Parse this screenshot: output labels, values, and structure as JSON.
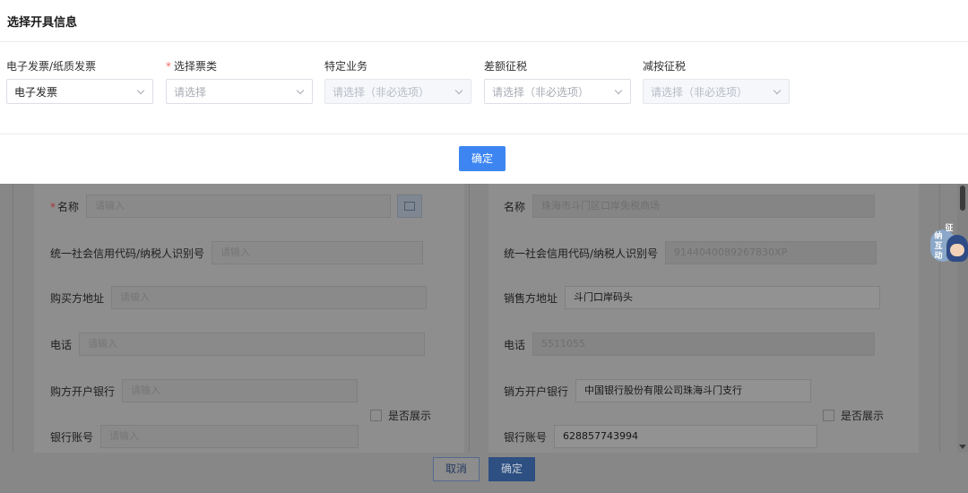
{
  "modal": {
    "title": "选择开具信息",
    "fields": [
      {
        "label": "电子发票/纸质发票",
        "required": false,
        "value": "电子发票",
        "placeholder": "",
        "disabled": false
      },
      {
        "label": "选择票类",
        "required": true,
        "value": "",
        "placeholder": "请选择",
        "disabled": false
      },
      {
        "label": "特定业务",
        "required": false,
        "value": "",
        "placeholder": "请选择（非必选项）",
        "disabled": true
      },
      {
        "label": "差额征税",
        "required": false,
        "value": "",
        "placeholder": "请选择（非必选项）",
        "disabled": false
      },
      {
        "label": "减按征税",
        "required": false,
        "value": "",
        "placeholder": "请选择（非必选项）",
        "disabled": true
      }
    ],
    "confirm_label": "确定"
  },
  "buyer": {
    "name_label": "名称",
    "name_placeholder": "请输入",
    "tax_id_label": "统一社会信用代码/纳税人识别号",
    "tax_id_placeholder": "请输入",
    "address_label": "购买方地址",
    "address_placeholder": "请输入",
    "phone_label": "电话",
    "phone_placeholder": "请输入",
    "bank_label": "购方开户银行",
    "bank_placeholder": "请输入",
    "show_label": "是否展示",
    "account_label": "银行账号",
    "account_placeholder": "请输入"
  },
  "seller": {
    "name_label": "名称",
    "name_value": "珠海市斗门区口岸免税商场",
    "tax_id_label": "统一社会信用代码/纳税人识别号",
    "tax_id_value": "9144040089267830XP",
    "address_label": "销售方地址",
    "address_value": "斗门口岸码头",
    "phone_label": "电话",
    "phone_value": "5511055",
    "bank_label": "销方开户银行",
    "bank_value": "中国银行股份有限公司珠海斗门支行",
    "show_label": "是否展示",
    "account_label": "银行账号",
    "account_value": "628857743994"
  },
  "footer": {
    "cancel_label": "取消",
    "confirm_label": "确定"
  },
  "mascot": {
    "chars": [
      "征",
      "纳",
      "互",
      "动"
    ]
  },
  "colors": {
    "primary": "#3d86f2",
    "required": "#f56c6c"
  }
}
